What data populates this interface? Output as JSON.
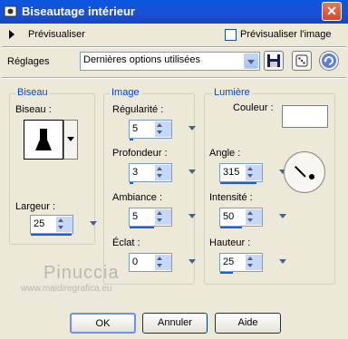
{
  "window": {
    "title": "Biseautage intérieur",
    "close_label": "✕"
  },
  "preview": {
    "label": "Prévisualiser",
    "checkbox_label": "Prévisualiser l'image"
  },
  "settings": {
    "label": "Réglages",
    "selected": "Dernières options utilisées"
  },
  "groups": {
    "bevel": {
      "title": "Biseau",
      "shape_label": "Biseau :",
      "width_label": "Largeur :",
      "width_value": "25"
    },
    "image": {
      "title": "Image",
      "smoothness_label": "Régularité :",
      "smoothness_value": "5",
      "depth_label": "Profondeur :",
      "depth_value": "3",
      "ambience_label": "Ambiance :",
      "ambience_value": "5",
      "shininess_label": "Éclat :",
      "shininess_value": "0"
    },
    "light": {
      "title": "Lumière",
      "color_label": "Couleur :",
      "color_value": "#ffffff",
      "angle_label": "Angle :",
      "angle_value": "315",
      "intensity_label": "Intensité :",
      "intensity_value": "50",
      "elevation_label": "Hauteur :",
      "elevation_value": "25"
    }
  },
  "watermark": {
    "name": "Pinuccia",
    "url": "www.maidiregrafica.eu"
  },
  "buttons": {
    "ok": "OK",
    "cancel": "Annuler",
    "help": "Aide"
  },
  "colors": {
    "title_bar": "#1c4fd4",
    "accent": "#0046d5",
    "dialog_bg": "#ece9d8"
  }
}
